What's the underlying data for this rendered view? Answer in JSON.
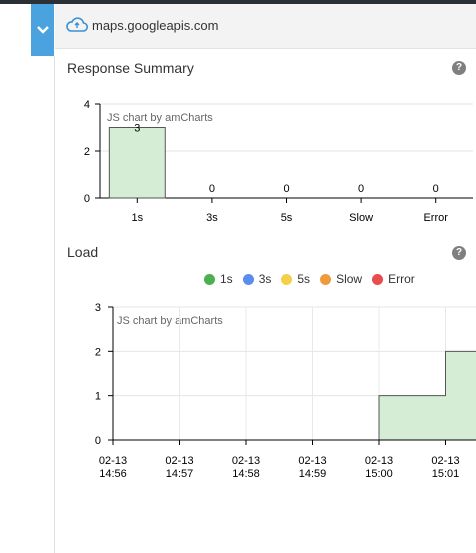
{
  "header": {
    "host": "maps.googleapis.com"
  },
  "response_summary": {
    "title": "Response Summary",
    "watermark": "JS chart by amCharts"
  },
  "load": {
    "title": "Load",
    "watermark": "JS chart by amCharts"
  },
  "icons": {
    "collapse": "chevron-down-icon",
    "host": "cloud-icon",
    "help": "question-icon"
  },
  "help_label": "?",
  "colors": {
    "bar_fill": "#d5ecd5",
    "bar_stroke": "#555555",
    "accent": "#4aa3df"
  },
  "legend": [
    {
      "label": "1s",
      "color": "#4caf50"
    },
    {
      "label": "3s",
      "color": "#5b8def"
    },
    {
      "label": "5s",
      "color": "#f5cf47"
    },
    {
      "label": "Slow",
      "color": "#ef9b3b"
    },
    {
      "label": "Error",
      "color": "#e84c4c"
    }
  ],
  "chart_data": [
    {
      "type": "bar",
      "categories": [
        "1s",
        "3s",
        "5s",
        "Slow",
        "Error"
      ],
      "values": [
        3,
        0,
        0,
        0,
        0
      ],
      "yticks": [
        0,
        2,
        4
      ],
      "ylim": [
        0,
        4
      ],
      "grid": true
    },
    {
      "type": "area",
      "x": [
        "02-13 14:56",
        "02-13 14:57",
        "02-13 14:58",
        "02-13 14:59",
        "02-13 15:00",
        "02-13 15:01"
      ],
      "series": [
        {
          "name": "1s",
          "values": [
            0,
            0,
            0,
            0,
            1,
            2
          ]
        },
        {
          "name": "3s",
          "values": [
            0,
            0,
            0,
            0,
            0,
            0
          ]
        },
        {
          "name": "5s",
          "values": [
            0,
            0,
            0,
            0,
            0,
            0
          ]
        },
        {
          "name": "Slow",
          "values": [
            0,
            0,
            0,
            0,
            0,
            0
          ]
        },
        {
          "name": "Error",
          "values": [
            0,
            0,
            0,
            0,
            0,
            0
          ]
        }
      ],
      "yticks": [
        0,
        1,
        2,
        3
      ],
      "ylim": [
        0,
        3
      ],
      "step": true,
      "grid": true
    }
  ]
}
